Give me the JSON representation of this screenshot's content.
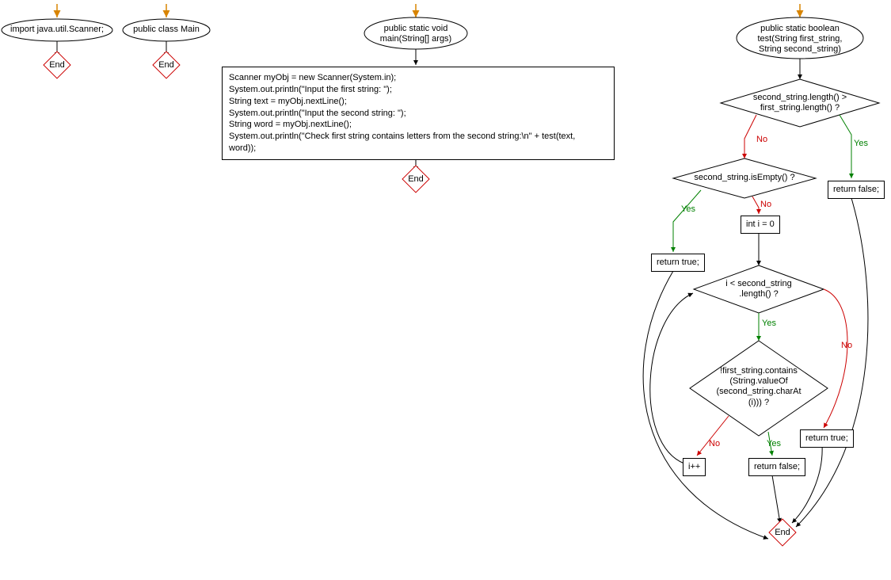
{
  "nodes": {
    "import_stmt": "import java.util.Scanner;",
    "class_decl": "public class Main",
    "main_sig": "public static void\nmain(String[] args)",
    "main_body": "Scanner myObj = new Scanner(System.in);\nSystem.out.println(\"Input the first string: \");\nString text = myObj.nextLine();\nSystem.out.println(\"Input the second string: \");\nString word = myObj.nextLine();\nSystem.out.println(\"Check first string contains letters from the second string:\\n\" + test(text,\nword));",
    "test_sig": "public static boolean\ntest(String first_string,\nString second_string)",
    "cond_len": "second_string.length() >\nfirst_string.length() ?",
    "cond_empty": "second_string.isEmpty() ?",
    "ret_false1": "return false;",
    "ret_true1": "return true;",
    "init_i": "int i = 0",
    "cond_loop": "i < second_string\n.length() ?",
    "cond_contains": "!first_string.contains\n(String.valueOf\n(second_string.charAt\n(i))) ?",
    "inc_i": "i++",
    "ret_false2": "return false;",
    "ret_true2": "return true;",
    "end": "End"
  },
  "labels": {
    "yes": "Yes",
    "no": "No"
  }
}
